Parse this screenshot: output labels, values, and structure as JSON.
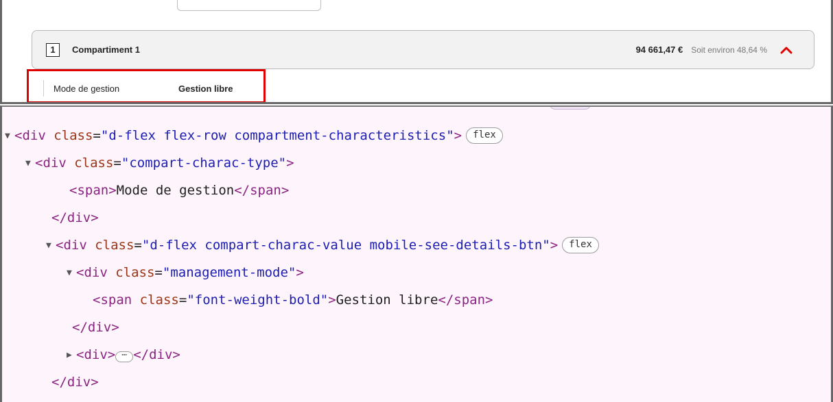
{
  "web": {
    "compartment": {
      "number": "1",
      "title": "Compartiment 1",
      "amount": "94 661,47 €",
      "share": "Soit environ 48,64 %",
      "expand_icon": "chevron-up-icon"
    },
    "characteristics": {
      "type_label": "Mode de gestion",
      "value": "Gestion libre"
    },
    "colors": {
      "highlight": "#e00000",
      "chevron": "#e00000"
    }
  },
  "devtools": {
    "line1": {
      "open": "<div",
      "attr": "class",
      "eq": "=",
      "value": "\"d-flex flex-row compartment-characteristics\"",
      "close": ">",
      "badge": "flex"
    },
    "line2": {
      "open": "<div",
      "attr": "class",
      "eq": "=",
      "value": "\"compart-charac-type\"",
      "close": ">"
    },
    "line3": {
      "open": "<span>",
      "text": "Mode de gestion",
      "close": "</span>"
    },
    "line4": {
      "tag": "</div>"
    },
    "line5": {
      "open": "<div",
      "attr": "class",
      "eq": "=",
      "value": "\"d-flex compart-charac-value mobile-see-details-btn\"",
      "close": ">",
      "badge": "flex"
    },
    "line6": {
      "open": "<div",
      "attr": "class",
      "eq": "=",
      "value": "\"management-mode\"",
      "close": ">"
    },
    "line7": {
      "open": "<span",
      "attr": "class",
      "eq": "=",
      "value": "\"font-weight-bold\"",
      "close": ">",
      "text": "Gestion libre",
      "end": "</span>"
    },
    "line8": {
      "tag": "</div>"
    },
    "line9": {
      "open": "<div>",
      "ellipsis": "⋯",
      "close": "</div>"
    },
    "line10": {
      "tag": "</div>"
    }
  }
}
